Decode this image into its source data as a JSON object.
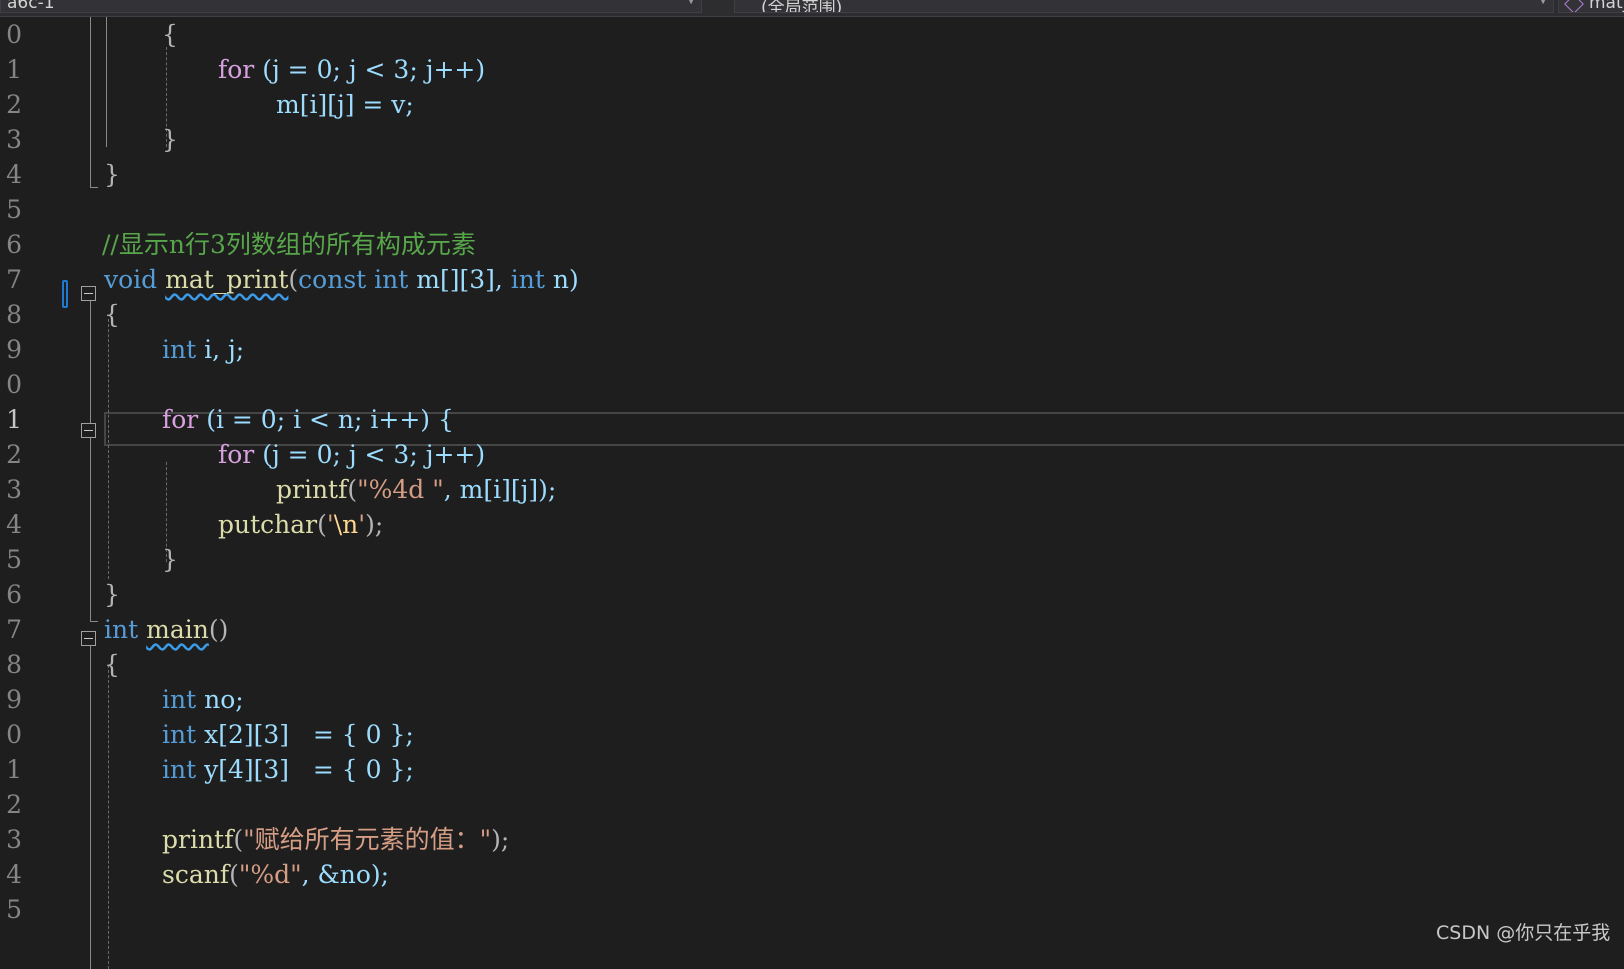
{
  "nav": {
    "project": "a6c-1",
    "scope": "(全局范围)",
    "member": "mat_"
  },
  "line_numbers": [
    "0",
    "1",
    "2",
    "3",
    "4",
    "5",
    "6",
    "7",
    "8",
    "9",
    "0",
    "1",
    "2",
    "3",
    "4",
    "5",
    "6",
    "7",
    "8",
    "9",
    "0",
    "1",
    "2",
    "3",
    "4",
    "5"
  ],
  "code": {
    "l0_brace": "{",
    "l1_for": "for",
    "l1_rest": "(j = 0; j < 3; j++)",
    "l2_stmt": "m[i][j] = v;",
    "l3_brace": "}",
    "l4_brace": "}",
    "comment": "//显示n行3列数组的所有构成元素",
    "sig_void": "void",
    "sig_name": "mat_print",
    "sig_open": "(",
    "sig_const": "const",
    "sig_int1": "int",
    "sig_m": "m[][3],",
    "sig_int2": "int",
    "sig_n": "n)",
    "l8_brace": "{",
    "l9_int": "int",
    "l9_vars": "i, j;",
    "l11_for": "for",
    "l11_rest": "(i = 0; i < n; i++) {",
    "l12_for": "for",
    "l12_rest": "(j = 0; j < 3; j++)",
    "l13_fn": "printf",
    "l13_open": "(",
    "l13_str": "\"%4d \"",
    "l13_rest": ", m[i][j]);",
    "l14_fn": "putchar",
    "l14_open": "(",
    "l14_q1": "'",
    "l14_esc": "\\n",
    "l14_q2": "'",
    "l14_close": ");",
    "l15_brace": "}",
    "l16_brace": "}",
    "main_int": "int",
    "main_name": "main",
    "main_paren": "()",
    "l18_brace": "{",
    "l19_int": "int",
    "l19_var": "no;",
    "l20_int": "int",
    "l20_rest": "x[2][3]   = { 0 };",
    "l21_int": "int",
    "l21_rest": "y[4][3]   = { 0 };",
    "l23_fn": "printf",
    "l23_open": "(",
    "l23_str": "\"赋给所有元素的值：\"",
    "l23_close": ");",
    "l24_fn": "scanf",
    "l24_open": "(",
    "l24_str": "\"%d\"",
    "l24_rest": ", &no);"
  },
  "watermark": "CSDN @你只在乎我",
  "colors": {
    "background": "#1e1e1e",
    "keyword": "#569cd6",
    "control": "#d8a0df",
    "function": "#dcdcaa",
    "string": "#d69d85",
    "comment": "#57a64a",
    "number": "#b5cea8"
  }
}
